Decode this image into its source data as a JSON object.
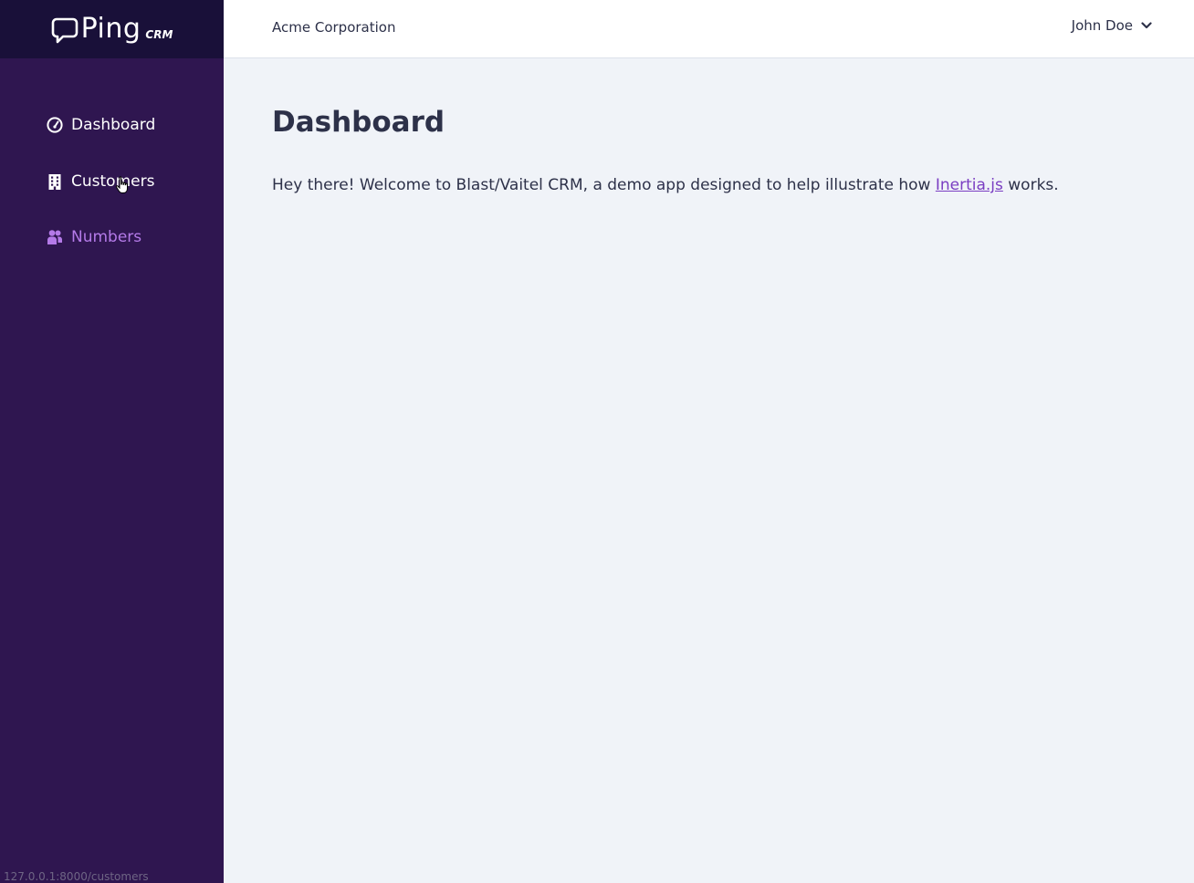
{
  "brand": {
    "name": "Ping",
    "suffix": "CRM"
  },
  "header": {
    "company": "Acme Corporation",
    "user": "John Doe"
  },
  "sidebar": {
    "items": [
      {
        "label": "Dashboard",
        "icon": "dashboard-gauge-icon",
        "active": false
      },
      {
        "label": "Customers",
        "icon": "building-icon",
        "active": false
      },
      {
        "label": "Numbers",
        "icon": "users-icon",
        "active": true
      }
    ]
  },
  "main": {
    "title": "Dashboard",
    "welcome_before": "Hey there! Welcome to Blast/Vaitel CRM, a demo app designed to help illustrate how ",
    "welcome_link": "Inertia.js",
    "welcome_after": " works."
  },
  "status_bar": {
    "url": "127.0.0.1:8000/customers"
  },
  "colors": {
    "sidebar_bg": "#2f1650",
    "logo_bg": "#191039",
    "active_nav": "#b47ae8",
    "link": "#7a3ec2",
    "content_bg": "#f0f3f8"
  }
}
